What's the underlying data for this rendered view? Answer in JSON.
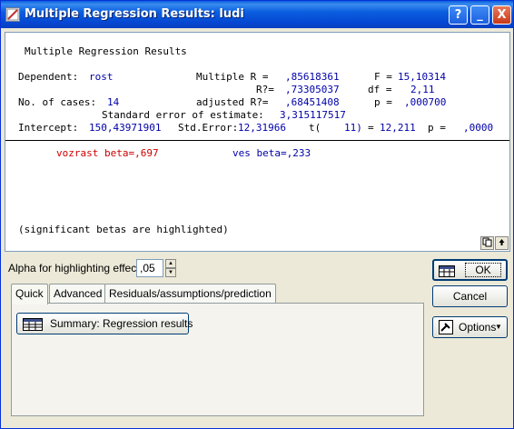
{
  "window": {
    "title": "Multiple Regression Results: ludi"
  },
  "titlebar_buttons": {
    "help": "?",
    "minimize": "_",
    "close": "X"
  },
  "output": {
    "heading": "Multiple Regression Results",
    "dependent_label": "Dependent:",
    "dependent_value": "rost",
    "multiple_r_label": "Multiple R =",
    "multiple_r_value": ",85618361",
    "f_label": "F =",
    "f_value": "15,10314",
    "r2_label": "R?=",
    "r2_value": ",73305037",
    "df_label": "df =",
    "df_value": "2,11",
    "cases_label": "No. of cases:",
    "cases_value": "14",
    "adj_r2_label": "adjusted R?=",
    "adj_r2_value": ",68451408",
    "p_label": "p =",
    "p_value": ",000700",
    "se_label": "Standard error of estimate:",
    "se_value": "3,315117517",
    "intercept_label": "Intercept:",
    "intercept_value": "150,43971901",
    "std_error_label": "Std.Error:",
    "std_error_value": "12,31966",
    "t_label": "t(",
    "t_df": "11)",
    "t_eq": "=",
    "t_value": "12,211",
    "p2_label": "p =",
    "p2_value": ",0000",
    "beta1": "vozrast beta=,697",
    "beta2": "ves beta=,233",
    "footnote": "(significant betas are highlighted)"
  },
  "alpha": {
    "label": "Alpha for highlighting effects:",
    "value": ",05"
  },
  "tabs": [
    {
      "label": "Quick"
    },
    {
      "label": "Advanced"
    },
    {
      "label": "Residuals/assumptions/prediction"
    }
  ],
  "summary_button": {
    "label": "Summary:  Regression results"
  },
  "buttons": {
    "ok": "OK",
    "cancel": "Cancel",
    "options": "Options"
  },
  "colors": {
    "titlebar": "#0a5ddd",
    "output_blue": "#0000aa",
    "highlight_red": "#cc0000"
  }
}
